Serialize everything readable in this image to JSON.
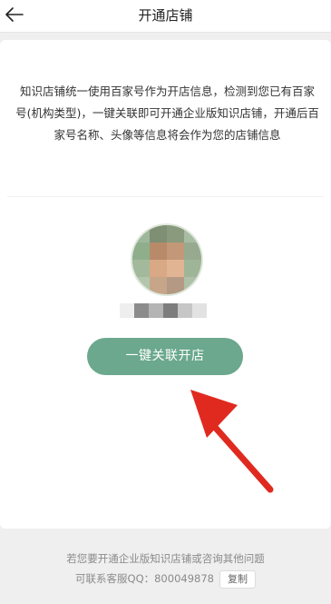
{
  "navbar": {
    "title": "开通店铺",
    "back_icon": "arrow-left-icon"
  },
  "notice": {
    "text": "知识店铺统一使用百家号作为开店信息，检测到您已有百家号(机构类型)，一键关联即可开通企业版知识店铺，开通后百家号名称、头像等信息将会作为您的店铺信息"
  },
  "account": {
    "avatar_icon": "blurred-avatar-icon",
    "name": ""
  },
  "actions": {
    "link_button_label": "一键关联开店"
  },
  "footer": {
    "line1": "若您要开通企业版知识店铺或咨询其他问题",
    "line2": "可联系客服QQ：800049878",
    "copy_label": "复制"
  },
  "colors": {
    "accent": "#6ba88d",
    "annotation_arrow": "#e02a20"
  }
}
